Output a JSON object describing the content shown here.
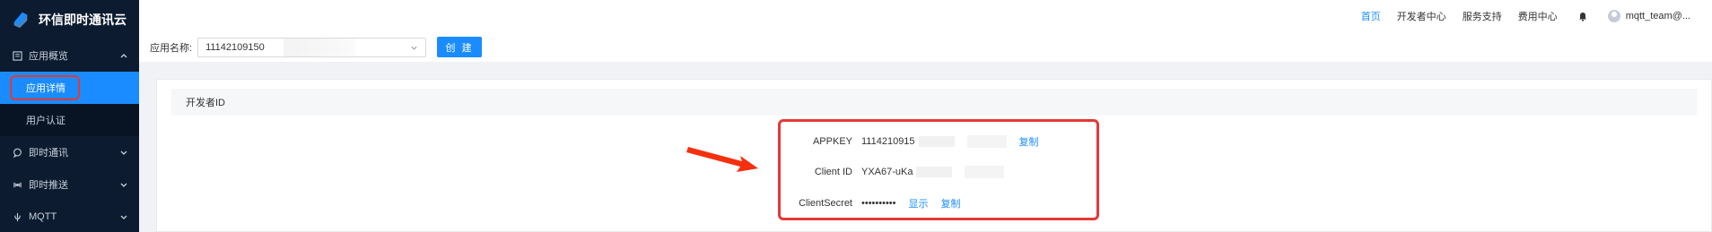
{
  "brand": {
    "name": "环信即时通讯云"
  },
  "sidebar": {
    "sections": [
      {
        "label": "应用概览",
        "icon": "app-overview-icon",
        "expanded": true,
        "children": [
          {
            "label": "应用详情",
            "active": true
          },
          {
            "label": "用户认证",
            "active": false
          }
        ]
      },
      {
        "label": "即时通讯",
        "icon": "chat-icon",
        "expanded": false
      },
      {
        "label": "即时推送",
        "icon": "push-icon",
        "expanded": false
      },
      {
        "label": "MQTT",
        "icon": "mqtt-icon",
        "expanded": false
      }
    ]
  },
  "topbar": {
    "nav": [
      "首页",
      "开发者中心",
      "服务支持",
      "费用中心"
    ],
    "active_nav": "首页",
    "user": "mqtt_team@..."
  },
  "app_row": {
    "label": "应用名称:",
    "selected_app": "11142109150",
    "create_label": "创 建"
  },
  "developer": {
    "section_title": "开发者ID",
    "appkey_label": "APPKEY",
    "appkey_value": "1114210915",
    "appkey_copy": "复制",
    "client_id_label": "Client ID",
    "client_id_value": "YXA67-uKa",
    "client_secret_label": "ClientSecret",
    "client_secret_value": "••••••••••",
    "show_label": "显示",
    "secret_copy": "复制"
  },
  "colors": {
    "accent": "#1a8cff",
    "sidebar_bg": "#0c1b2f",
    "highlight": "#e53935"
  }
}
